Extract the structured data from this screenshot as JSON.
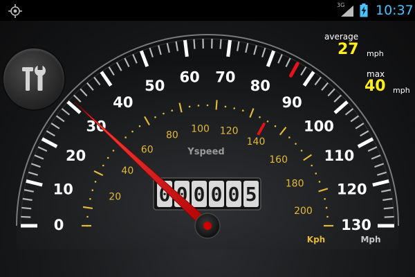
{
  "status_bar": {
    "network": "3G",
    "time": "10:37",
    "icons": [
      "gps-icon",
      "signal-icon",
      "battery-charging-icon"
    ]
  },
  "stats": {
    "average": {
      "label": "average",
      "value": "27",
      "unit": "mph"
    },
    "max": {
      "label": "max",
      "value": "40",
      "unit": "mph"
    }
  },
  "gauge": {
    "mph_labels": [
      "0",
      "10",
      "20",
      "30",
      "40",
      "50",
      "60",
      "70",
      "80",
      "90",
      "100",
      "110",
      "120",
      "130"
    ],
    "mph_unit": "Mph",
    "mph_max": 130,
    "kph_labels": [
      "20",
      "40",
      "60",
      "80",
      "100",
      "120",
      "140",
      "160",
      "180",
      "200"
    ],
    "kph_unit": "Kph",
    "kph_max": 210,
    "brand": "Yspeed",
    "odometer": [
      "0",
      "0",
      "0",
      "0",
      "0",
      "5"
    ],
    "current_speed_mph": 31,
    "max_marker_mph": 86,
    "colors": {
      "needle": "#e3121b",
      "kph_scale": "#e2b93a",
      "stat_value": "#ffee1a",
      "clock": "#4cc3ff"
    }
  },
  "tools_button": {
    "icon": "tools-icon"
  }
}
